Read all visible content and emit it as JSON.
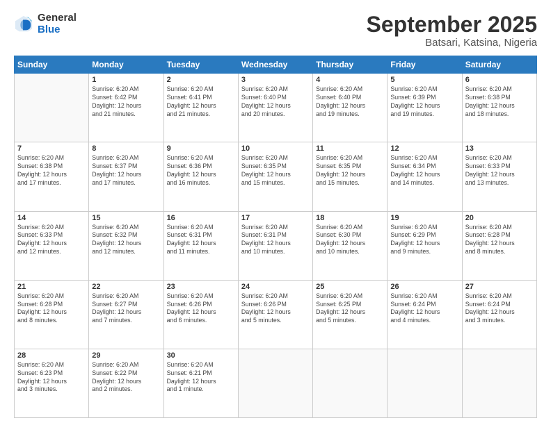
{
  "header": {
    "logo_general": "General",
    "logo_blue": "Blue",
    "month_title": "September 2025",
    "location": "Batsari, Katsina, Nigeria"
  },
  "weekdays": [
    "Sunday",
    "Monday",
    "Tuesday",
    "Wednesday",
    "Thursday",
    "Friday",
    "Saturday"
  ],
  "weeks": [
    [
      {
        "day": "",
        "info": ""
      },
      {
        "day": "1",
        "info": "Sunrise: 6:20 AM\nSunset: 6:42 PM\nDaylight: 12 hours\nand 21 minutes."
      },
      {
        "day": "2",
        "info": "Sunrise: 6:20 AM\nSunset: 6:41 PM\nDaylight: 12 hours\nand 21 minutes."
      },
      {
        "day": "3",
        "info": "Sunrise: 6:20 AM\nSunset: 6:40 PM\nDaylight: 12 hours\nand 20 minutes."
      },
      {
        "day": "4",
        "info": "Sunrise: 6:20 AM\nSunset: 6:40 PM\nDaylight: 12 hours\nand 19 minutes."
      },
      {
        "day": "5",
        "info": "Sunrise: 6:20 AM\nSunset: 6:39 PM\nDaylight: 12 hours\nand 19 minutes."
      },
      {
        "day": "6",
        "info": "Sunrise: 6:20 AM\nSunset: 6:38 PM\nDaylight: 12 hours\nand 18 minutes."
      }
    ],
    [
      {
        "day": "7",
        "info": "Sunrise: 6:20 AM\nSunset: 6:38 PM\nDaylight: 12 hours\nand 17 minutes."
      },
      {
        "day": "8",
        "info": "Sunrise: 6:20 AM\nSunset: 6:37 PM\nDaylight: 12 hours\nand 17 minutes."
      },
      {
        "day": "9",
        "info": "Sunrise: 6:20 AM\nSunset: 6:36 PM\nDaylight: 12 hours\nand 16 minutes."
      },
      {
        "day": "10",
        "info": "Sunrise: 6:20 AM\nSunset: 6:35 PM\nDaylight: 12 hours\nand 15 minutes."
      },
      {
        "day": "11",
        "info": "Sunrise: 6:20 AM\nSunset: 6:35 PM\nDaylight: 12 hours\nand 15 minutes."
      },
      {
        "day": "12",
        "info": "Sunrise: 6:20 AM\nSunset: 6:34 PM\nDaylight: 12 hours\nand 14 minutes."
      },
      {
        "day": "13",
        "info": "Sunrise: 6:20 AM\nSunset: 6:33 PM\nDaylight: 12 hours\nand 13 minutes."
      }
    ],
    [
      {
        "day": "14",
        "info": "Sunrise: 6:20 AM\nSunset: 6:33 PM\nDaylight: 12 hours\nand 12 minutes."
      },
      {
        "day": "15",
        "info": "Sunrise: 6:20 AM\nSunset: 6:32 PM\nDaylight: 12 hours\nand 12 minutes."
      },
      {
        "day": "16",
        "info": "Sunrise: 6:20 AM\nSunset: 6:31 PM\nDaylight: 12 hours\nand 11 minutes."
      },
      {
        "day": "17",
        "info": "Sunrise: 6:20 AM\nSunset: 6:31 PM\nDaylight: 12 hours\nand 10 minutes."
      },
      {
        "day": "18",
        "info": "Sunrise: 6:20 AM\nSunset: 6:30 PM\nDaylight: 12 hours\nand 10 minutes."
      },
      {
        "day": "19",
        "info": "Sunrise: 6:20 AM\nSunset: 6:29 PM\nDaylight: 12 hours\nand 9 minutes."
      },
      {
        "day": "20",
        "info": "Sunrise: 6:20 AM\nSunset: 6:28 PM\nDaylight: 12 hours\nand 8 minutes."
      }
    ],
    [
      {
        "day": "21",
        "info": "Sunrise: 6:20 AM\nSunset: 6:28 PM\nDaylight: 12 hours\nand 8 minutes."
      },
      {
        "day": "22",
        "info": "Sunrise: 6:20 AM\nSunset: 6:27 PM\nDaylight: 12 hours\nand 7 minutes."
      },
      {
        "day": "23",
        "info": "Sunrise: 6:20 AM\nSunset: 6:26 PM\nDaylight: 12 hours\nand 6 minutes."
      },
      {
        "day": "24",
        "info": "Sunrise: 6:20 AM\nSunset: 6:26 PM\nDaylight: 12 hours\nand 5 minutes."
      },
      {
        "day": "25",
        "info": "Sunrise: 6:20 AM\nSunset: 6:25 PM\nDaylight: 12 hours\nand 5 minutes."
      },
      {
        "day": "26",
        "info": "Sunrise: 6:20 AM\nSunset: 6:24 PM\nDaylight: 12 hours\nand 4 minutes."
      },
      {
        "day": "27",
        "info": "Sunrise: 6:20 AM\nSunset: 6:24 PM\nDaylight: 12 hours\nand 3 minutes."
      }
    ],
    [
      {
        "day": "28",
        "info": "Sunrise: 6:20 AM\nSunset: 6:23 PM\nDaylight: 12 hours\nand 3 minutes."
      },
      {
        "day": "29",
        "info": "Sunrise: 6:20 AM\nSunset: 6:22 PM\nDaylight: 12 hours\nand 2 minutes."
      },
      {
        "day": "30",
        "info": "Sunrise: 6:20 AM\nSunset: 6:21 PM\nDaylight: 12 hours\nand 1 minute."
      },
      {
        "day": "",
        "info": ""
      },
      {
        "day": "",
        "info": ""
      },
      {
        "day": "",
        "info": ""
      },
      {
        "day": "",
        "info": ""
      }
    ]
  ]
}
